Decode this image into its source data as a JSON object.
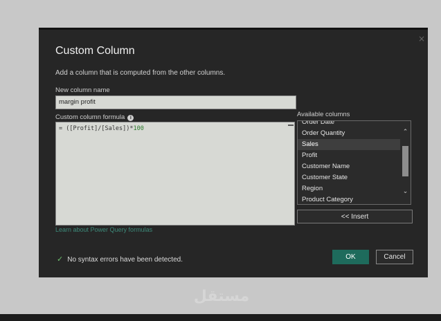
{
  "dialog": {
    "title": "Custom Column",
    "description": "Add a column that is computed from the other columns.",
    "close_glyph": "×"
  },
  "new_column": {
    "label": "New column name",
    "value": "margin profit"
  },
  "formula": {
    "label": "Custom column formula",
    "info_glyph": "i",
    "prefix": "= ([Profit]/[Sales])*",
    "number": "100"
  },
  "available_columns": {
    "label": "Available columns",
    "items": [
      {
        "label": "Order Date"
      },
      {
        "label": "Order Quantity"
      },
      {
        "label": "Sales",
        "selected": true
      },
      {
        "label": "Profit"
      },
      {
        "label": "Customer Name"
      },
      {
        "label": "Customer State"
      },
      {
        "label": "Region"
      },
      {
        "label": "Product Category"
      }
    ]
  },
  "insert_label": "<< Insert",
  "learn_link": "Learn about Power Query formulas",
  "status": {
    "check_glyph": "✓",
    "text": "No syntax errors have been detected."
  },
  "buttons": {
    "ok": "OK",
    "cancel": "Cancel"
  },
  "watermark": "مستقل",
  "icons": {
    "info": "info-icon",
    "check": "check-icon",
    "scroll_up": "chevron-up-icon",
    "scroll_down": "chevron-down-icon",
    "close": "close-icon"
  }
}
